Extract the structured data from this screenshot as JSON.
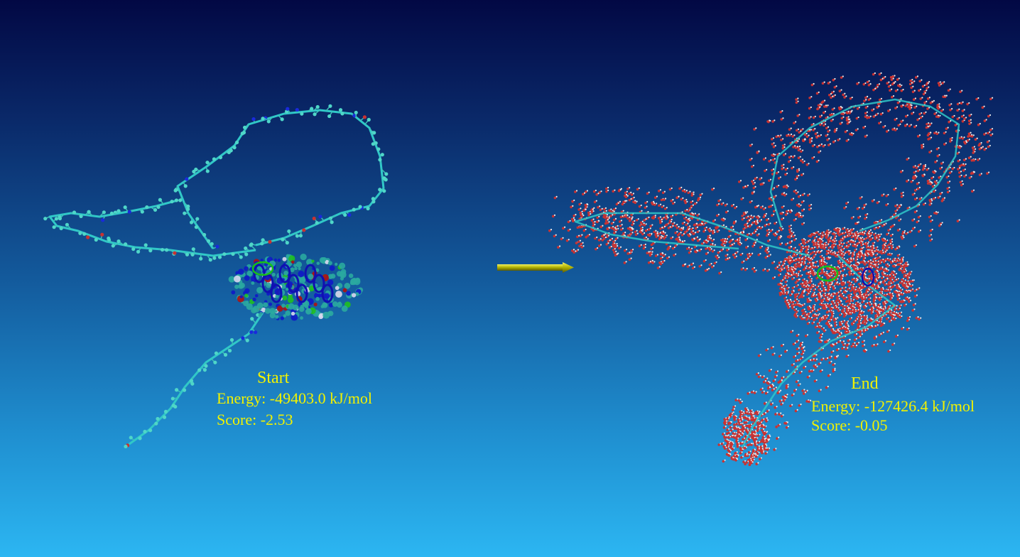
{
  "start_panel": {
    "title": "Start",
    "energy": "Energy: -49403.0 kJ/mol",
    "score": "Score: -2.53"
  },
  "end_panel": {
    "title": "End",
    "energy": "Energy: -127426.4 kJ/mol",
    "score": "Score: -0.05"
  },
  "colors": {
    "label_text": "#f2f200",
    "backbone": "#30c8c8",
    "water_oxygen": "#c83232",
    "water_hydrogen": "#ececec",
    "nitrogen": "#1a2adc",
    "arrow": "#b8b800"
  }
}
